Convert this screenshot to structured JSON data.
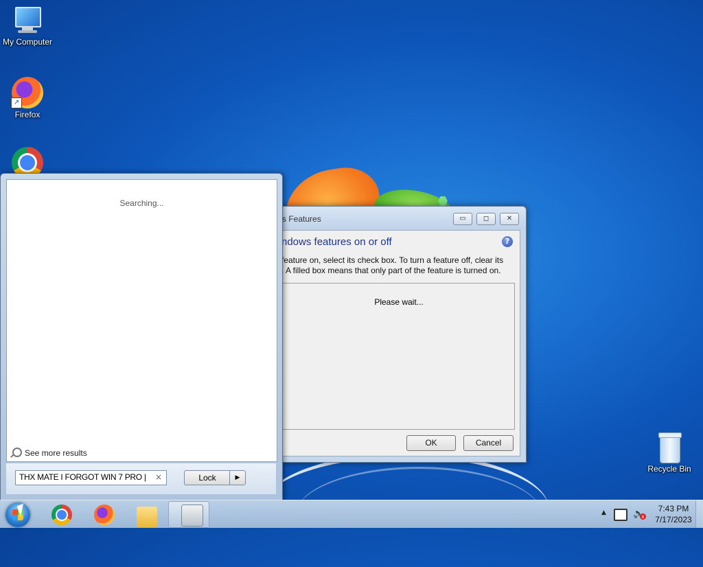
{
  "desktop": {
    "icons": [
      {
        "label": "My Computer",
        "icon": "computer-icon"
      },
      {
        "label": "Firefox",
        "icon": "firefox-icon"
      },
      {
        "label": "",
        "icon": "chrome-icon"
      },
      {
        "label": "Recycle Bin",
        "icon": "recycle-bin-icon"
      }
    ]
  },
  "dialog": {
    "title": "s Features",
    "heading": "ndows features on or off",
    "description_line1": "feature on, select its check box. To turn a feature off, clear its",
    "description_line2": ". A filled box means that only part of the feature is turned on.",
    "status": "Please wait...",
    "ok_label": "OK",
    "cancel_label": "Cancel",
    "minimize_glyph": "▭",
    "maximize_glyph": "◻",
    "close_glyph": "✕",
    "help_glyph": "?"
  },
  "start_menu": {
    "status": "Searching...",
    "see_more": "See more results",
    "search_value": "THX MATE I FORGOT WIN 7 PRO |",
    "clear_glyph": "×",
    "lock_label": "Lock",
    "lock_arrow": "▶"
  },
  "taskbar": {
    "apps": [
      {
        "name": "chrome",
        "icon": "chrome-icon"
      },
      {
        "name": "firefox",
        "icon": "firefox-icon"
      },
      {
        "name": "explorer",
        "icon": "folder-icon"
      },
      {
        "name": "windows-features",
        "icon": "windows-features-icon"
      }
    ],
    "tray": {
      "chevron": "▲",
      "volume_glyph": "🔈",
      "mute_glyph": "x"
    },
    "clock": {
      "time": "7:43 PM",
      "date": "7/17/2023"
    }
  }
}
